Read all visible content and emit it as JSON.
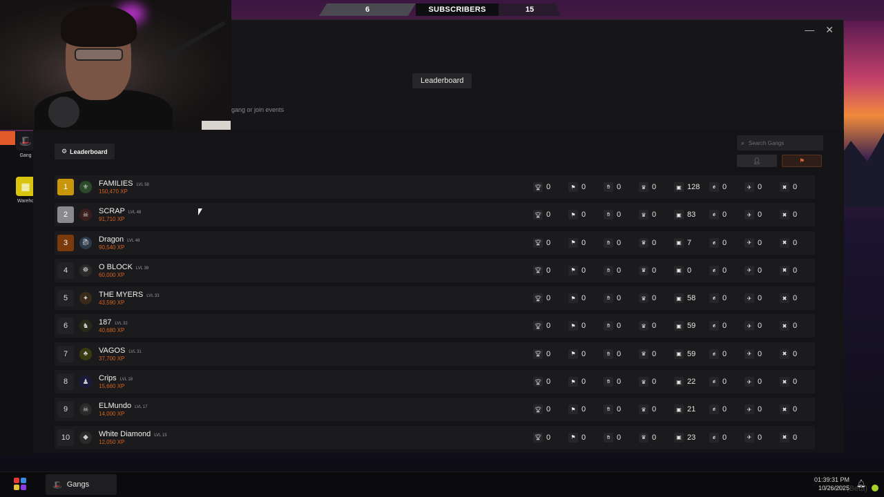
{
  "subscriber_banner": {
    "left_count": "6",
    "label": "SUBSCRIBERS",
    "right_count": "15"
  },
  "window": {
    "minimize": "—",
    "close": "✕",
    "center_title": "Leaderboard",
    "hint": "gang or join events"
  },
  "desktop_icons": [
    {
      "label": "Gang",
      "icon": "hat-icon"
    },
    {
      "label": "Wareho",
      "icon": "warehouse-icon"
    }
  ],
  "leaderboard": {
    "tab_label": "Leaderboard",
    "search_placeholder": "Search Gangs",
    "toggle_user_icon": "user-icon",
    "toggle_gang_icon": "group-icon",
    "stat_icons": [
      "trophy-icon",
      "flag-icon",
      "hands-icon",
      "crown-icon",
      "vault-icon",
      "hand-icon",
      "plane-icon",
      "tools-icon"
    ],
    "accent": "#d8621e",
    "rows": [
      {
        "rank": "1",
        "name": "FAMILIES",
        "level": "LVL 58",
        "xp": "150,470 XP",
        "stats": [
          "0",
          "0",
          "0",
          "0",
          "128",
          "0",
          "0",
          "0"
        ]
      },
      {
        "rank": "2",
        "name": "SCRAP",
        "level": "LVL 48",
        "xp": "91,710 XP",
        "stats": [
          "0",
          "0",
          "0",
          "0",
          "83",
          "0",
          "0",
          "0"
        ]
      },
      {
        "rank": "3",
        "name": "Dragon",
        "level": "LVL 48",
        "xp": "90,540 XP",
        "stats": [
          "0",
          "0",
          "0",
          "0",
          "7",
          "0",
          "0",
          "0"
        ]
      },
      {
        "rank": "4",
        "name": "O BLOCK",
        "level": "LVL 39",
        "xp": "60,000 XP",
        "stats": [
          "0",
          "0",
          "0",
          "0",
          "0",
          "0",
          "0",
          "0"
        ]
      },
      {
        "rank": "5",
        "name": "THE MYERS",
        "level": "LVL 33",
        "xp": "43,590 XP",
        "stats": [
          "0",
          "0",
          "0",
          "0",
          "58",
          "0",
          "0",
          "0"
        ]
      },
      {
        "rank": "6",
        "name": "187",
        "level": "LVL 32",
        "xp": "40,680 XP",
        "stats": [
          "0",
          "0",
          "0",
          "0",
          "59",
          "0",
          "0",
          "0"
        ]
      },
      {
        "rank": "7",
        "name": "VAGOS",
        "level": "LVL 31",
        "xp": "37,700 XP",
        "stats": [
          "0",
          "0",
          "0",
          "0",
          "59",
          "0",
          "0",
          "0"
        ]
      },
      {
        "rank": "8",
        "name": "Crips",
        "level": "LVL 18",
        "xp": "15,660 XP",
        "stats": [
          "0",
          "0",
          "0",
          "0",
          "22",
          "0",
          "0",
          "0"
        ]
      },
      {
        "rank": "9",
        "name": "ELMundo",
        "level": "LVL 17",
        "xp": "14,000 XP",
        "stats": [
          "0",
          "0",
          "0",
          "0",
          "21",
          "0",
          "0",
          "0"
        ]
      },
      {
        "rank": "10",
        "name": "White Diamond",
        "level": "LVL 15",
        "xp": "12,050 XP",
        "stats": [
          "0",
          "0",
          "0",
          "0",
          "23",
          "0",
          "0",
          "0"
        ]
      }
    ]
  },
  "taskbar": {
    "app_label": "Gangs",
    "time": "01:39:31 PM",
    "date": "10/26/2025",
    "watermark": "FiveM (Beta)"
  }
}
